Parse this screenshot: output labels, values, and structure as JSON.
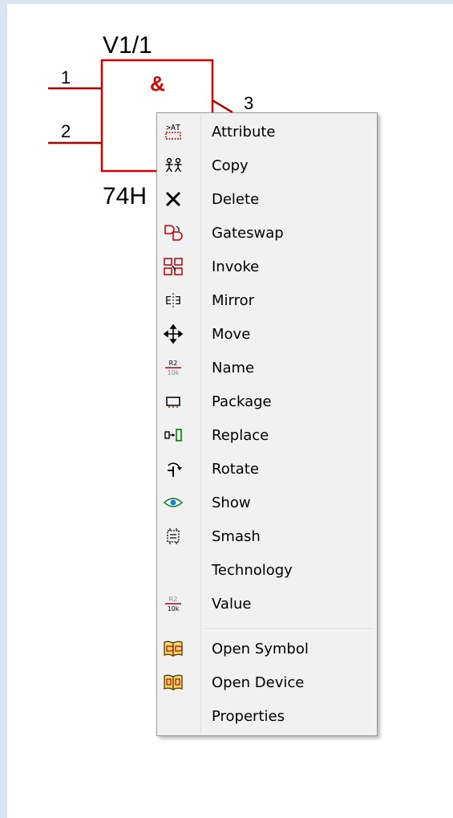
{
  "schematic": {
    "part_name": "V1/1",
    "gate_symbol": "&",
    "part_value": "74H",
    "pins": [
      "1",
      "2",
      "3"
    ],
    "colors": {
      "symbol": "#d40000",
      "wire": "#b00000",
      "text": "#000000"
    }
  },
  "context_menu": {
    "items": [
      {
        "label": "Attribute",
        "icon": "attribute-icon"
      },
      {
        "label": "Copy",
        "icon": "copy-icon"
      },
      {
        "label": "Delete",
        "icon": "delete-icon"
      },
      {
        "label": "Gateswap",
        "icon": "gateswap-icon"
      },
      {
        "label": "Invoke",
        "icon": "invoke-icon"
      },
      {
        "label": "Mirror",
        "icon": "mirror-icon"
      },
      {
        "label": "Move",
        "icon": "move-icon"
      },
      {
        "label": "Name",
        "icon": "name-icon"
      },
      {
        "label": "Package",
        "icon": "package-icon"
      },
      {
        "label": "Replace",
        "icon": "replace-icon"
      },
      {
        "label": "Rotate",
        "icon": "rotate-icon"
      },
      {
        "label": "Show",
        "icon": "show-eye-icon"
      },
      {
        "label": "Smash",
        "icon": "smash-icon"
      },
      {
        "label": "Technology",
        "icon": ""
      },
      {
        "label": "Value",
        "icon": "value-icon"
      }
    ],
    "extra_items": [
      {
        "label": "Open Symbol",
        "icon": "open-symbol-icon"
      },
      {
        "label": "Open Device",
        "icon": "open-device-icon"
      },
      {
        "label": "Properties",
        "icon": ""
      }
    ],
    "icon_text": {
      "attr": ">AT",
      "name_top": "R2",
      "name_bottom": "10k"
    }
  }
}
